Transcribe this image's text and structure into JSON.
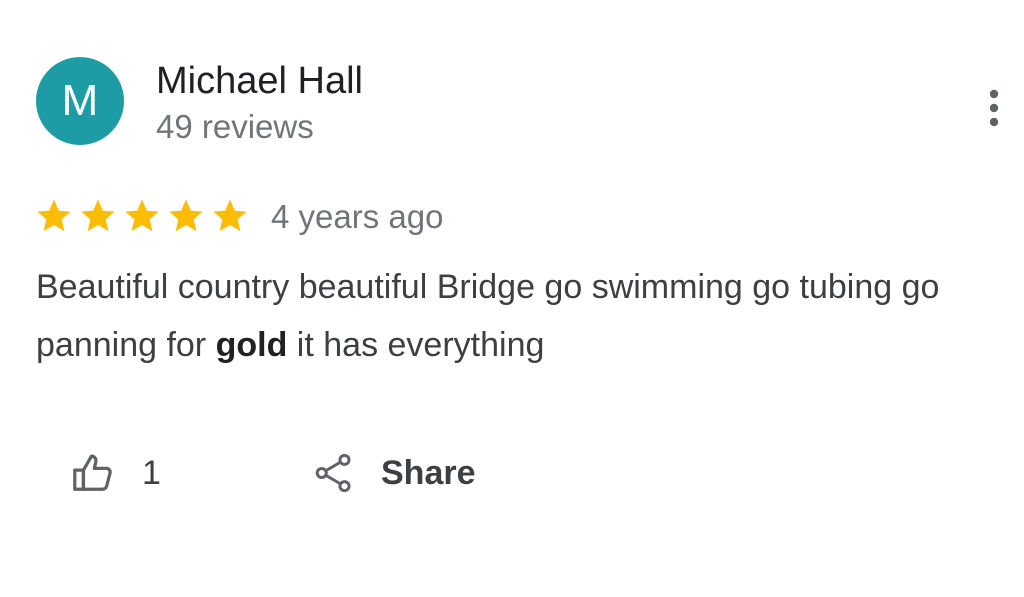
{
  "author": {
    "initial": "M",
    "name": "Michael Hall",
    "reviews": "49 reviews",
    "avatar_color": "#1e9ca5"
  },
  "review": {
    "rating": 5,
    "max_rating": 5,
    "star_color": "#fbbc04",
    "date": "4 years ago",
    "text_before": "Beautiful country beautiful Bridge go swimming go tubing go panning for ",
    "text_bold": "gold",
    "text_after": " it has everything"
  },
  "actions": {
    "like_icon": "thumbs-up-icon",
    "like_count": "1",
    "share_icon": "share-icon",
    "share_label": "Share",
    "more_icon": "more-vert-icon"
  }
}
